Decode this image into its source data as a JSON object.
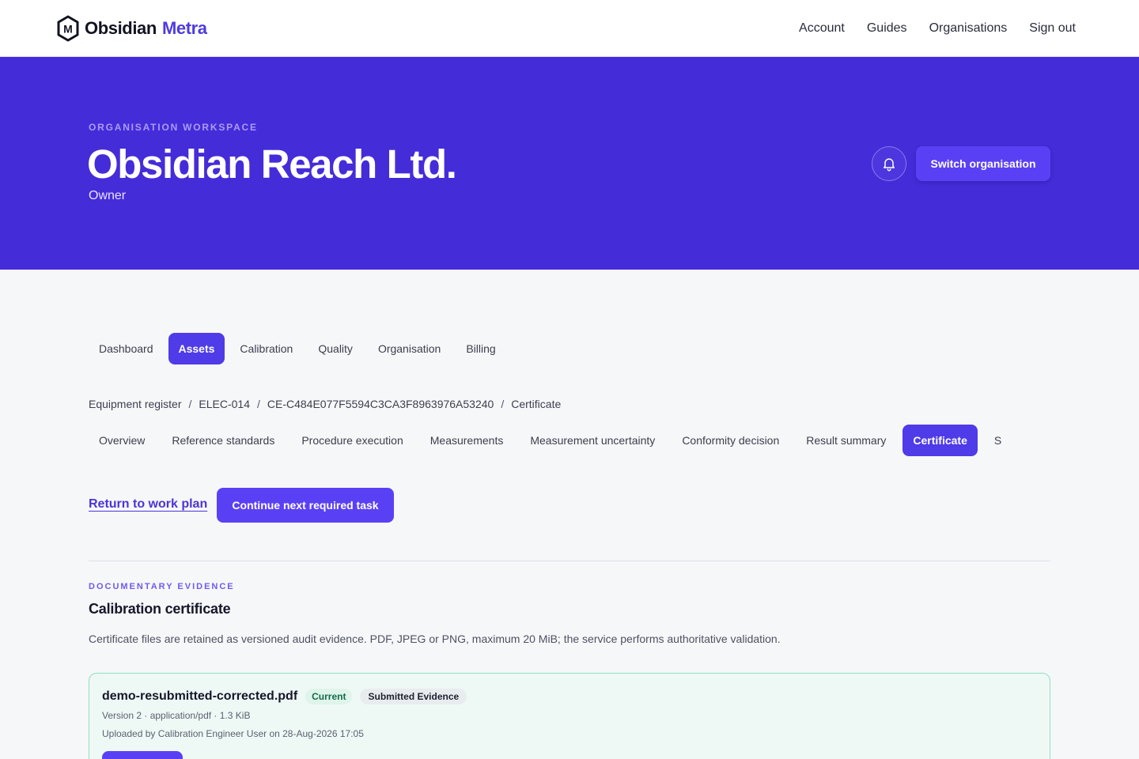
{
  "brand": {
    "name": "Obsidian",
    "accent": "Metra",
    "logo_letter": "M",
    "logo_icon": "hexagon-m-logo"
  },
  "topnav": [
    {
      "label": "Account"
    },
    {
      "label": "Guides"
    },
    {
      "label": "Organisations"
    },
    {
      "label": "Sign out"
    }
  ],
  "hero": {
    "eyebrow": "ORGANISATION WORKSPACE",
    "title": "Obsidian Reach Ltd.",
    "role": "Owner",
    "bell_icon": "bell-icon",
    "switch_label": "Switch organisation"
  },
  "main_tabs": [
    {
      "label": "Dashboard",
      "active": false
    },
    {
      "label": "Assets",
      "active": true
    },
    {
      "label": "Calibration",
      "active": false
    },
    {
      "label": "Quality",
      "active": false
    },
    {
      "label": "Organisation",
      "active": false
    },
    {
      "label": "Billing",
      "active": false
    }
  ],
  "breadcrumb": [
    {
      "label": "Equipment register"
    },
    {
      "label": "ELEC-014"
    },
    {
      "label": "CE-C484E077F5594C3CA3F8963976A53240"
    },
    {
      "label": "Certificate"
    }
  ],
  "breadcrumb_separator": "/",
  "sub_tabs": [
    {
      "label": "Overview",
      "active": false
    },
    {
      "label": "Reference standards",
      "active": false
    },
    {
      "label": "Procedure execution",
      "active": false
    },
    {
      "label": "Measurements",
      "active": false
    },
    {
      "label": "Measurement uncertainty",
      "active": false
    },
    {
      "label": "Conformity decision",
      "active": false
    },
    {
      "label": "Result summary",
      "active": false
    },
    {
      "label": "Certificate",
      "active": true
    },
    {
      "label": "S",
      "active": false
    }
  ],
  "actions": {
    "return_label": "Return to work plan",
    "continue_label": "Continue next required task"
  },
  "section": {
    "eyebrow": "DOCUMENTARY EVIDENCE",
    "title": "Calibration certificate",
    "description": "Certificate files are retained as versioned audit evidence. PDF, JPEG or PNG, maximum 20 MiB; the service performs authoritative validation."
  },
  "file": {
    "name": "demo-resubmitted-corrected.pdf",
    "badge_current": "Current",
    "badge_submitted": "Submitted Evidence",
    "meta": "Version 2 · application/pdf · 1.3 KiB",
    "uploaded": "Uploaded by Calibration Engineer User on 28-Aug-2026 17:05"
  },
  "colors": {
    "brand": "#452cd9",
    "accent": "#5a40f5",
    "success_border": "#8fe0c1",
    "success_bg": "#eef9f5"
  }
}
